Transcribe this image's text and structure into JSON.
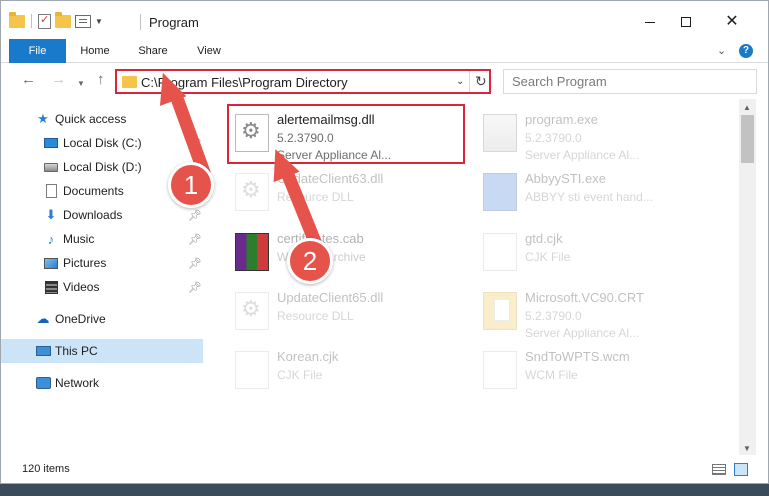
{
  "window": {
    "title": "Program",
    "status_text": "120 items"
  },
  "ribbon": {
    "tabs": [
      "File",
      "Home",
      "Share",
      "View"
    ]
  },
  "address": {
    "path": "C:\\Program Files\\Program Directory",
    "search_placeholder": "Search Program"
  },
  "navigation": {
    "quick_access": "Quick access",
    "items": [
      {
        "label": "Local Disk (C:)",
        "pinned": true
      },
      {
        "label": "Local Disk (D:)",
        "pinned": false
      },
      {
        "label": "Documents",
        "pinned": true
      },
      {
        "label": "Downloads",
        "pinned": true
      },
      {
        "label": "Music",
        "pinned": true
      },
      {
        "label": "Pictures",
        "pinned": true
      },
      {
        "label": "Videos",
        "pinned": true
      }
    ],
    "onedrive": "OneDrive",
    "this_pc": "This PC",
    "network": "Network"
  },
  "files": [
    {
      "name": "alertemailmsg.dll",
      "line1": "5.2.3790.0",
      "line2": "Server Appliance Al...",
      "highlighted": true
    },
    {
      "name": "program.exe",
      "line1": "5.2.3790.0",
      "line2": "Server Appliance Al...",
      "highlighted": false
    },
    {
      "name": "UpdateClient63.dll",
      "line1": "Resource DLL",
      "line2": "",
      "highlighted": false
    },
    {
      "name": "AbbyySTI.exe",
      "line1": "ABBYY sti event hand...",
      "line2": "",
      "highlighted": false
    },
    {
      "name": "certificates.cab",
      "line1": "WinRAR Archive",
      "line2": "",
      "highlighted": false
    },
    {
      "name": "gtd.cjk",
      "line1": "CJK File",
      "line2": "",
      "highlighted": false
    },
    {
      "name": "UpdateClient65.dll",
      "line1": "Resource DLL",
      "line2": "",
      "highlighted": false
    },
    {
      "name": "Microsoft.VC90.CRT",
      "line1": "5.2.3790.0",
      "line2": "Server Appliance Al...",
      "highlighted": false
    },
    {
      "name": "Korean.cjk",
      "line1": "CJK File",
      "line2": "",
      "highlighted": false
    },
    {
      "name": "SndToWPTS.wcm",
      "line1": "WCM File",
      "line2": "",
      "highlighted": false
    }
  ],
  "annotations": {
    "step1": "1",
    "step2": "2",
    "accent_color": "#e5534b"
  }
}
